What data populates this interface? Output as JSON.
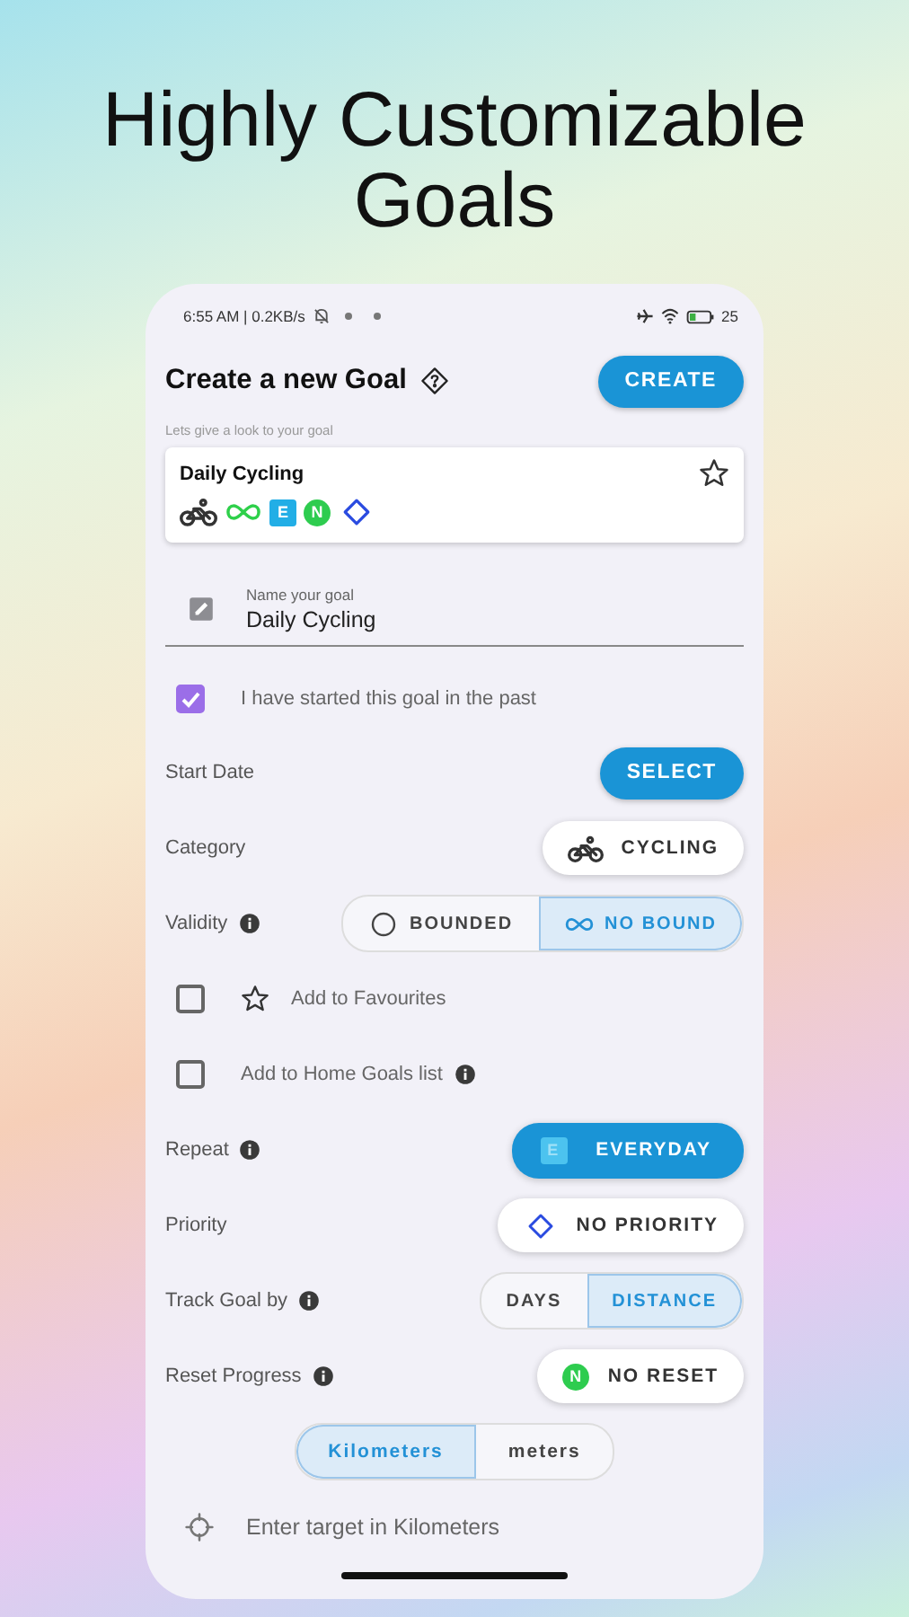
{
  "headline": "Highly Customizable Goals",
  "status_bar": {
    "info": "6:55 AM | 0.2KB/s",
    "battery": "25"
  },
  "header": {
    "title": "Create a new Goal",
    "create_button": "CREATE"
  },
  "preview": {
    "caption": "Lets give a look to your goal",
    "title": "Daily Cycling",
    "favourite": false,
    "badges": [
      {
        "kind": "bike"
      },
      {
        "kind": "infinity"
      },
      {
        "kind": "square-letter",
        "text": "E"
      },
      {
        "kind": "round-letter",
        "text": "N"
      },
      {
        "kind": "diamond"
      }
    ]
  },
  "name_field": {
    "label": "Name your goal",
    "value": "Daily Cycling"
  },
  "past_start": {
    "label": "I have started this goal in the past",
    "checked": true
  },
  "rows": [
    {
      "kind": "button",
      "label": "Start Date",
      "button": "SELECT"
    },
    {
      "kind": "chip",
      "label": "Category",
      "icon": {
        "kind": "bike"
      },
      "value": "CYCLING"
    },
    {
      "kind": "toggle",
      "label": "Validity",
      "info": true,
      "options": [
        {
          "label": "BOUNDED",
          "selected": false
        },
        {
          "label": "NO BOUND",
          "selected": true
        }
      ]
    },
    {
      "kind": "checkbox",
      "label": "Add to Favourites",
      "checked": false
    },
    {
      "kind": "checkbox",
      "label": "Add to Home Goals list",
      "info": true,
      "checked": false
    },
    {
      "kind": "filled-chip",
      "label": "Repeat",
      "info": true,
      "icon": {
        "kind": "square-letter",
        "text": "E"
      },
      "value": "EVERYDAY"
    },
    {
      "kind": "chip",
      "label": "Priority",
      "icon": {
        "kind": "diamond"
      },
      "value": "NO PRIORITY"
    },
    {
      "kind": "toggle",
      "label": "Track Goal by",
      "info": true,
      "options": [
        {
          "label": "DAYS",
          "selected": false
        },
        {
          "label": "DISTANCE",
          "selected": true
        }
      ]
    },
    {
      "kind": "chip",
      "label": "Reset Progress",
      "info": true,
      "icon": {
        "kind": "round-letter",
        "text": "N"
      },
      "value": "NO RESET"
    },
    {
      "kind": "units",
      "options": [
        {
          "label": "Kilometers",
          "selected": true
        },
        {
          "label": "meters",
          "selected": false
        }
      ]
    },
    {
      "kind": "target",
      "placeholder": "Enter target in Kilometers"
    }
  ]
}
